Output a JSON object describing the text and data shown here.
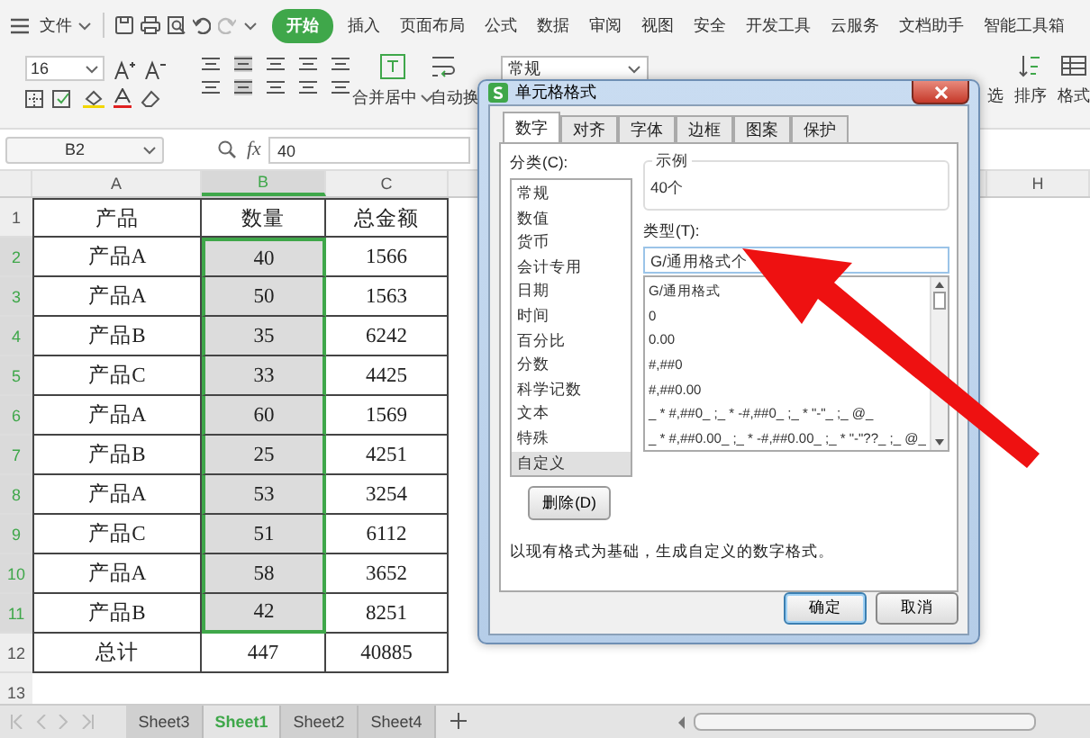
{
  "menu": {
    "file": "文件",
    "tabs": [
      {
        "label": "开始",
        "selected": true
      },
      {
        "label": "插入",
        "selected": false
      },
      {
        "label": "页面布局",
        "selected": false
      },
      {
        "label": "公式",
        "selected": false
      },
      {
        "label": "数据",
        "selected": false
      },
      {
        "label": "审阅",
        "selected": false
      },
      {
        "label": "视图",
        "selected": false
      },
      {
        "label": "安全",
        "selected": false
      },
      {
        "label": "开发工具",
        "selected": false
      },
      {
        "label": "云服务",
        "selected": false
      },
      {
        "label": "文档助手",
        "selected": false
      },
      {
        "label": "智能工具箱",
        "selected": false
      }
    ]
  },
  "ribbon": {
    "font_size": "16",
    "merge": "合并居中",
    "wrap": "自动换",
    "number_format": "常规",
    "filter": "选",
    "sort": "排序",
    "format": "格式"
  },
  "formula_bar": {
    "cell_ref": "B2",
    "fx": "fx",
    "value": "40"
  },
  "sheet": {
    "columns": [
      {
        "label": "A",
        "selected": false
      },
      {
        "label": "B",
        "selected": true
      },
      {
        "label": "C",
        "selected": false
      }
    ],
    "hidden_column": "H",
    "rows": [
      {
        "number": "1",
        "selected": false,
        "cells": [
          "产品",
          "数量",
          "总金额"
        ]
      },
      {
        "number": "2",
        "selected": true,
        "cells": [
          "产品A",
          "40",
          "1566"
        ]
      },
      {
        "number": "3",
        "selected": true,
        "cells": [
          "产品A",
          "50",
          "1563"
        ]
      },
      {
        "number": "4",
        "selected": true,
        "cells": [
          "产品B",
          "35",
          "6242"
        ]
      },
      {
        "number": "5",
        "selected": true,
        "cells": [
          "产品C",
          "33",
          "4425"
        ]
      },
      {
        "number": "6",
        "selected": true,
        "cells": [
          "产品A",
          "60",
          "1569"
        ]
      },
      {
        "number": "7",
        "selected": true,
        "cells": [
          "产品B",
          "25",
          "4251"
        ]
      },
      {
        "number": "8",
        "selected": true,
        "cells": [
          "产品A",
          "53",
          "3254"
        ]
      },
      {
        "number": "9",
        "selected": true,
        "cells": [
          "产品C",
          "51",
          "6112"
        ]
      },
      {
        "number": "10",
        "selected": true,
        "cells": [
          "产品A",
          "58",
          "3652"
        ]
      },
      {
        "number": "11",
        "selected": true,
        "cells": [
          "产品B",
          "42",
          "8251"
        ]
      },
      {
        "number": "12",
        "selected": false,
        "cells": [
          "总计",
          "447",
          "40885"
        ]
      }
    ],
    "empty_row": "13"
  },
  "sheet_tabs": [
    {
      "label": "Sheet3",
      "selected": false
    },
    {
      "label": "Sheet1",
      "selected": true
    },
    {
      "label": "Sheet2",
      "selected": false
    },
    {
      "label": "Sheet4",
      "selected": false
    }
  ],
  "dialog": {
    "title": "单元格格式",
    "tabs": [
      {
        "label": "数字",
        "selected": true
      },
      {
        "label": "对齐",
        "selected": false
      },
      {
        "label": "字体",
        "selected": false
      },
      {
        "label": "边框",
        "selected": false
      },
      {
        "label": "图案",
        "selected": false
      },
      {
        "label": "保护",
        "selected": false
      }
    ],
    "category_label": "分类(C):",
    "categories": [
      {
        "label": "常规",
        "selected": false
      },
      {
        "label": "数值",
        "selected": false
      },
      {
        "label": "货币",
        "selected": false
      },
      {
        "label": "会计专用",
        "selected": false
      },
      {
        "label": "日期",
        "selected": false
      },
      {
        "label": "时间",
        "selected": false
      },
      {
        "label": "百分比",
        "selected": false
      },
      {
        "label": "分数",
        "selected": false
      },
      {
        "label": "科学记数",
        "selected": false
      },
      {
        "label": "文本",
        "selected": false
      },
      {
        "label": "特殊",
        "selected": false
      },
      {
        "label": "自定义",
        "selected": true
      }
    ],
    "sample_label": "示例",
    "sample": "40个",
    "type_label": "类型(T):",
    "type_value": "G/通用格式个",
    "formats": [
      "G/通用格式",
      "0",
      "0.00",
      "#,##0",
      "#,##0.00",
      "_ * #,##0_ ;_ * -#,##0_ ;_ * \"-\"_ ;_ @_",
      "_ * #,##0.00_ ;_ * -#,##0.00_ ;_ * \"-\"??_ ;_ @_"
    ],
    "delete_button": "删除(D)",
    "description": "以现有格式为基础，生成自定义的数字格式。",
    "ok": "确定",
    "cancel": "取消"
  }
}
